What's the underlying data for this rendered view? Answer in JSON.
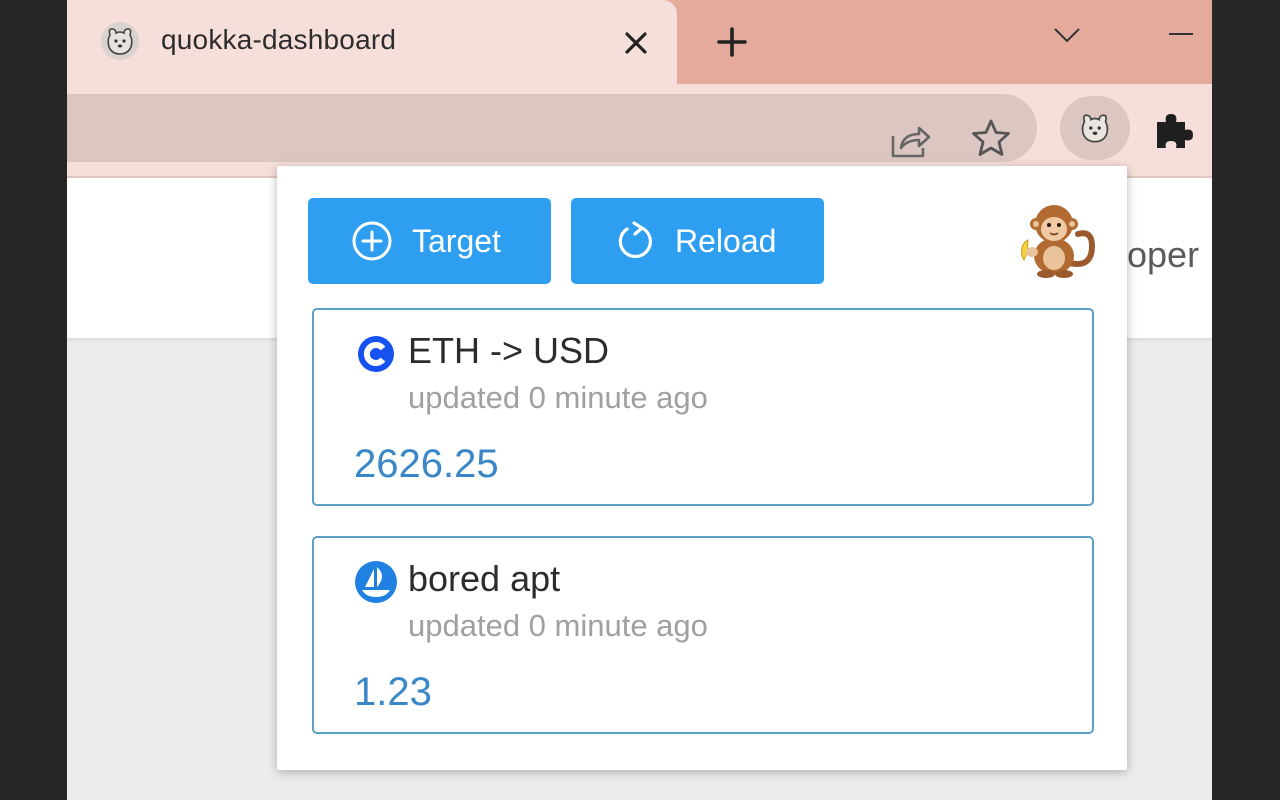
{
  "browser": {
    "tab_title": "quokka-dashboard",
    "tab_favicon": "quokka-icon",
    "icons": {
      "close": "close-icon",
      "new_tab": "plus-icon",
      "tab_search": "chevron-down-icon",
      "minimize": "minimize-icon",
      "share": "share-icon",
      "bookmark": "star-icon",
      "extension": "quokka-icon",
      "extensions_menu": "puzzle-icon"
    }
  },
  "page": {
    "header_text_visible": "oper"
  },
  "popup": {
    "buttons": {
      "target_label": "Target",
      "reload_label": "Reload"
    },
    "mascot": "monkey-icon",
    "accent_color": "#2e9ff0",
    "cards": [
      {
        "icon": "coinbase-icon",
        "title": "ETH -> USD",
        "updated": "updated 0 minute ago",
        "value": "2626.25"
      },
      {
        "icon": "opensea-icon",
        "title": "bored apt",
        "updated": "updated 0 minute ago",
        "value": "1.23"
      }
    ]
  }
}
